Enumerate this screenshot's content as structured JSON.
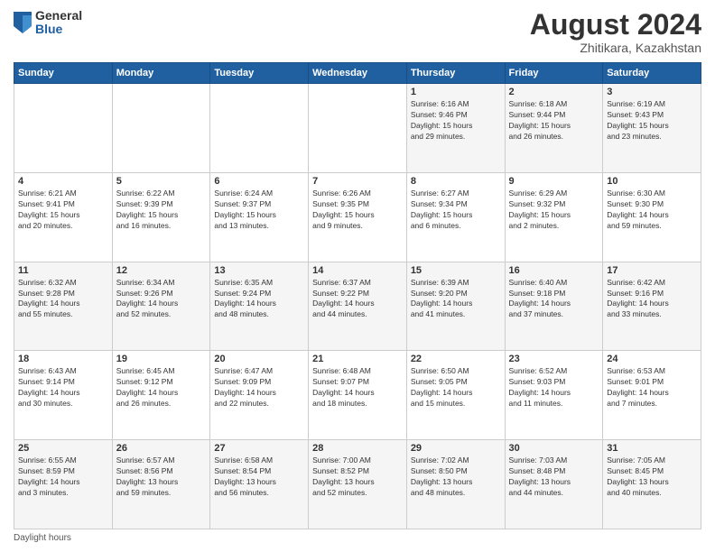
{
  "header": {
    "logo_general": "General",
    "logo_blue": "Blue",
    "title": "August 2024",
    "subtitle": "Zhitikara, Kazakhstan"
  },
  "days_of_week": [
    "Sunday",
    "Monday",
    "Tuesday",
    "Wednesday",
    "Thursday",
    "Friday",
    "Saturday"
  ],
  "weeks": [
    [
      {
        "day": "",
        "info": ""
      },
      {
        "day": "",
        "info": ""
      },
      {
        "day": "",
        "info": ""
      },
      {
        "day": "",
        "info": ""
      },
      {
        "day": "1",
        "info": "Sunrise: 6:16 AM\nSunset: 9:46 PM\nDaylight: 15 hours\nand 29 minutes."
      },
      {
        "day": "2",
        "info": "Sunrise: 6:18 AM\nSunset: 9:44 PM\nDaylight: 15 hours\nand 26 minutes."
      },
      {
        "day": "3",
        "info": "Sunrise: 6:19 AM\nSunset: 9:43 PM\nDaylight: 15 hours\nand 23 minutes."
      }
    ],
    [
      {
        "day": "4",
        "info": "Sunrise: 6:21 AM\nSunset: 9:41 PM\nDaylight: 15 hours\nand 20 minutes."
      },
      {
        "day": "5",
        "info": "Sunrise: 6:22 AM\nSunset: 9:39 PM\nDaylight: 15 hours\nand 16 minutes."
      },
      {
        "day": "6",
        "info": "Sunrise: 6:24 AM\nSunset: 9:37 PM\nDaylight: 15 hours\nand 13 minutes."
      },
      {
        "day": "7",
        "info": "Sunrise: 6:26 AM\nSunset: 9:35 PM\nDaylight: 15 hours\nand 9 minutes."
      },
      {
        "day": "8",
        "info": "Sunrise: 6:27 AM\nSunset: 9:34 PM\nDaylight: 15 hours\nand 6 minutes."
      },
      {
        "day": "9",
        "info": "Sunrise: 6:29 AM\nSunset: 9:32 PM\nDaylight: 15 hours\nand 2 minutes."
      },
      {
        "day": "10",
        "info": "Sunrise: 6:30 AM\nSunset: 9:30 PM\nDaylight: 14 hours\nand 59 minutes."
      }
    ],
    [
      {
        "day": "11",
        "info": "Sunrise: 6:32 AM\nSunset: 9:28 PM\nDaylight: 14 hours\nand 55 minutes."
      },
      {
        "day": "12",
        "info": "Sunrise: 6:34 AM\nSunset: 9:26 PM\nDaylight: 14 hours\nand 52 minutes."
      },
      {
        "day": "13",
        "info": "Sunrise: 6:35 AM\nSunset: 9:24 PM\nDaylight: 14 hours\nand 48 minutes."
      },
      {
        "day": "14",
        "info": "Sunrise: 6:37 AM\nSunset: 9:22 PM\nDaylight: 14 hours\nand 44 minutes."
      },
      {
        "day": "15",
        "info": "Sunrise: 6:39 AM\nSunset: 9:20 PM\nDaylight: 14 hours\nand 41 minutes."
      },
      {
        "day": "16",
        "info": "Sunrise: 6:40 AM\nSunset: 9:18 PM\nDaylight: 14 hours\nand 37 minutes."
      },
      {
        "day": "17",
        "info": "Sunrise: 6:42 AM\nSunset: 9:16 PM\nDaylight: 14 hours\nand 33 minutes."
      }
    ],
    [
      {
        "day": "18",
        "info": "Sunrise: 6:43 AM\nSunset: 9:14 PM\nDaylight: 14 hours\nand 30 minutes."
      },
      {
        "day": "19",
        "info": "Sunrise: 6:45 AM\nSunset: 9:12 PM\nDaylight: 14 hours\nand 26 minutes."
      },
      {
        "day": "20",
        "info": "Sunrise: 6:47 AM\nSunset: 9:09 PM\nDaylight: 14 hours\nand 22 minutes."
      },
      {
        "day": "21",
        "info": "Sunrise: 6:48 AM\nSunset: 9:07 PM\nDaylight: 14 hours\nand 18 minutes."
      },
      {
        "day": "22",
        "info": "Sunrise: 6:50 AM\nSunset: 9:05 PM\nDaylight: 14 hours\nand 15 minutes."
      },
      {
        "day": "23",
        "info": "Sunrise: 6:52 AM\nSunset: 9:03 PM\nDaylight: 14 hours\nand 11 minutes."
      },
      {
        "day": "24",
        "info": "Sunrise: 6:53 AM\nSunset: 9:01 PM\nDaylight: 14 hours\nand 7 minutes."
      }
    ],
    [
      {
        "day": "25",
        "info": "Sunrise: 6:55 AM\nSunset: 8:59 PM\nDaylight: 14 hours\nand 3 minutes."
      },
      {
        "day": "26",
        "info": "Sunrise: 6:57 AM\nSunset: 8:56 PM\nDaylight: 13 hours\nand 59 minutes."
      },
      {
        "day": "27",
        "info": "Sunrise: 6:58 AM\nSunset: 8:54 PM\nDaylight: 13 hours\nand 56 minutes."
      },
      {
        "day": "28",
        "info": "Sunrise: 7:00 AM\nSunset: 8:52 PM\nDaylight: 13 hours\nand 52 minutes."
      },
      {
        "day": "29",
        "info": "Sunrise: 7:02 AM\nSunset: 8:50 PM\nDaylight: 13 hours\nand 48 minutes."
      },
      {
        "day": "30",
        "info": "Sunrise: 7:03 AM\nSunset: 8:48 PM\nDaylight: 13 hours\nand 44 minutes."
      },
      {
        "day": "31",
        "info": "Sunrise: 7:05 AM\nSunset: 8:45 PM\nDaylight: 13 hours\nand 40 minutes."
      }
    ]
  ],
  "footer": "Daylight hours"
}
